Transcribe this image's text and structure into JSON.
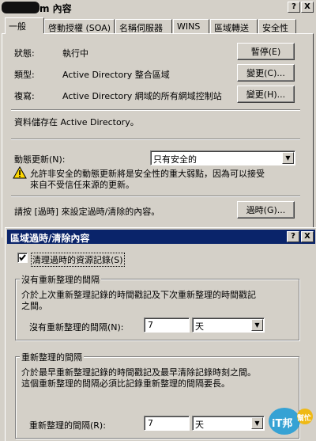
{
  "outer": {
    "title": "m 內容",
    "close_glyph": "X",
    "help_glyph": "?",
    "tabs": [
      {
        "label": "一般"
      },
      {
        "label": "啓動授權 (SOA)"
      },
      {
        "label": "名稱伺服器"
      },
      {
        "label": "WINS"
      },
      {
        "label": "區域轉送"
      },
      {
        "label": "安全性"
      }
    ],
    "status_label": "狀態:",
    "status_value": "執行中",
    "pause_button": "暫停(E)",
    "type_label": "類型:",
    "type_value": "Active Directory 整合區域",
    "change_type_button": "變更(C)...",
    "replication_label": "複寫:",
    "replication_value": "Active Directory 網域的所有網域控制站",
    "change_repl_button": "變更(H)...",
    "storage_text": "資料儲存在 Active Directory。",
    "dynamic_update_label": "動態更新(N):",
    "dynamic_update_value": "只有安全的",
    "warning_text_1": "允許非安全的動態更新將是安全性的重大弱點，因為可以接受",
    "warning_text_2": "來自不受信任來源的更新。",
    "aging_text": "請按 [過時] 來設定過時/清除的內容。",
    "aging_button": "過時(G)..."
  },
  "inner": {
    "title": "區域過時/清除內容",
    "help_glyph": "?",
    "close_glyph": "X",
    "scavenge_checkbox_label": "清理過時的資源記錄(S)",
    "scavenge_checked": true,
    "norefresh_group_title": "沒有重新整理的間隔",
    "norefresh_desc_1": "介於上次重新整理記錄的時間戳記及下次重新整理的時間戳記",
    "norefresh_desc_2": "之間。",
    "norefresh_label": "沒有重新整理的間隔(N):",
    "norefresh_value": "7",
    "norefresh_unit": "天",
    "refresh_group_title": "重新整理的間隔",
    "refresh_desc_1": "介於最早重新整理記錄的時間戳記及最早清除記錄時刻之間。",
    "refresh_desc_2": "這個重新整理的間隔必須比記錄重新整理的間隔要長。",
    "refresh_label": "重新整理的間隔(R):",
    "refresh_value": "7",
    "refresh_unit": "天"
  },
  "watermark": {
    "text_main": "iT邦",
    "text_sub": "幫忙"
  },
  "colors": {
    "titlebar": "#0a246a",
    "dialog_bg": "#d4d0c8",
    "warning_yellow": "#ffd800"
  }
}
